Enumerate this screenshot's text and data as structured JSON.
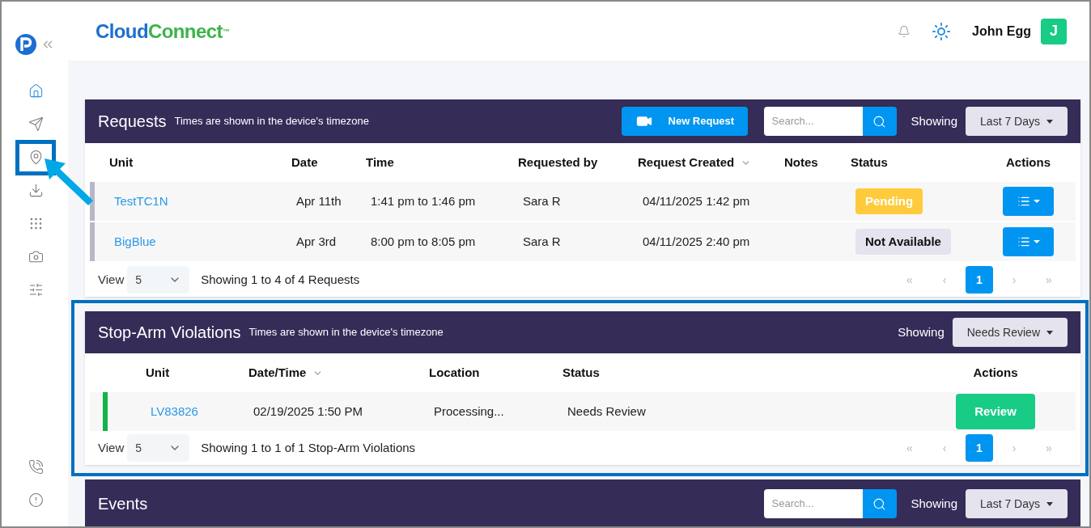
{
  "sidebar": {
    "items": [
      {
        "kind": "home",
        "selected": true,
        "highlighted": false
      },
      {
        "kind": "send",
        "selected": false,
        "highlighted": false
      },
      {
        "kind": "pin",
        "selected": false,
        "highlighted": true
      },
      {
        "kind": "download",
        "selected": false,
        "highlighted": false
      },
      {
        "kind": "grid",
        "selected": false,
        "highlighted": false
      },
      {
        "kind": "camera",
        "selected": false,
        "highlighted": false
      },
      {
        "kind": "sliders",
        "selected": false,
        "highlighted": false
      }
    ],
    "bottom_items": [
      {
        "kind": "phone"
      },
      {
        "kind": "alert"
      }
    ]
  },
  "header": {
    "logo_part_1": "Cloud",
    "logo_part_2": "Connect",
    "logo_mark": "™",
    "user_name": "John Egg",
    "avatar_letter": "J"
  },
  "requests": {
    "title": "Requests",
    "subtitle": "Times are shown in the device's timezone",
    "new_button": "New Request",
    "search_placeholder": "Search...",
    "showing_label": "Showing",
    "filter": "Last 7 Days",
    "columns": [
      {
        "label": "Unit",
        "sortable": false
      },
      {
        "label": "Date",
        "sortable": false
      },
      {
        "label": "Time",
        "sortable": false
      },
      {
        "label": "Requested by",
        "sortable": false
      },
      {
        "label": "Request Created",
        "sortable": true
      },
      {
        "label": "Notes",
        "sortable": false
      },
      {
        "label": "Status",
        "sortable": false
      },
      {
        "label": "Actions",
        "sortable": false
      }
    ],
    "rows": [
      {
        "color": "#b9b6c8",
        "unit": "TestTC1N",
        "date": "Apr 11th",
        "time": "1:41 pm to 1:46 pm",
        "requested_by": "Sara R",
        "created": "04/11/2025 1:42 pm",
        "status": "Pending",
        "kind": "pending"
      },
      {
        "color": "#b9b6c8",
        "unit": "BigBlue",
        "date": "Apr 3rd",
        "time": "8:00 pm to 8:05 pm",
        "requested_by": "Sara R",
        "created": "04/11/2025 2:40 pm",
        "status": "Not Available",
        "kind": "unavailable"
      }
    ],
    "view_label": "View",
    "page_size": "5",
    "summary": "Showing 1 to 4 of 4 Requests",
    "pagination": [
      {
        "label": "«",
        "selected": false
      },
      {
        "label": "‹",
        "selected": false
      },
      {
        "label": "1",
        "selected": true
      },
      {
        "label": "›",
        "selected": false
      },
      {
        "label": "»",
        "selected": false
      }
    ]
  },
  "violations": {
    "highlighted": true,
    "title": "Stop-Arm Violations",
    "subtitle": "Times are shown in the device's timezone",
    "showing_label": "Showing",
    "filter": "Needs Review",
    "columns": [
      {
        "label": "Unit",
        "sortable": false
      },
      {
        "label": "Date/Time",
        "sortable": true
      },
      {
        "label": "Location",
        "sortable": false
      },
      {
        "label": "Status",
        "sortable": false
      },
      {
        "label": "Actions",
        "sortable": false
      }
    ],
    "rows": [
      {
        "color": "#12b347",
        "unit": "LV83826",
        "datetime": "02/19/2025 1:50 PM",
        "location": "Processing...",
        "status": "Needs Review",
        "action": "Review"
      }
    ],
    "view_label": "View",
    "page_size": "5",
    "summary": "Showing 1 to 1 of 1 Stop-Arm Violations",
    "pagination": [
      {
        "label": "«",
        "selected": false
      },
      {
        "label": "‹",
        "selected": false
      },
      {
        "label": "1",
        "selected": true
      },
      {
        "label": "›",
        "selected": false
      },
      {
        "label": "»",
        "selected": false
      }
    ]
  },
  "events": {
    "title": "Events",
    "search_placeholder": "Search...",
    "showing_label": "Showing",
    "filter": "Last 7 Days"
  }
}
